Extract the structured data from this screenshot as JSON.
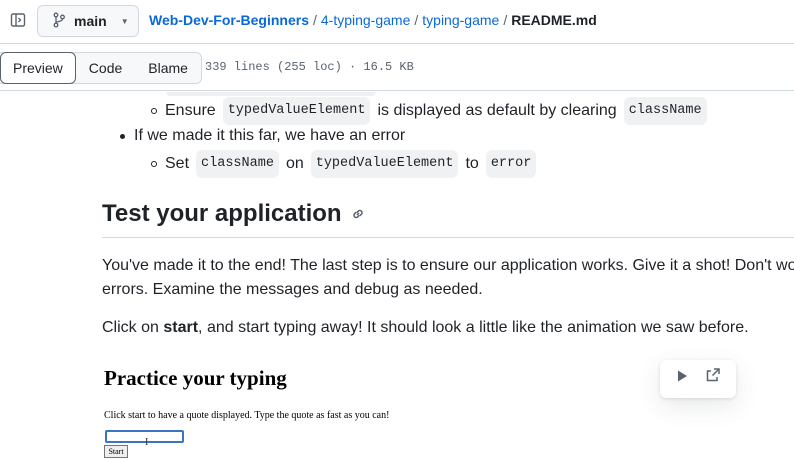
{
  "header": {
    "branch": "main",
    "breadcrumb": {
      "repo": "Web-Dev-For-Beginners",
      "folder1": "4-typing-game",
      "folder2": "typing-game",
      "file": "README.md",
      "separator": "/"
    }
  },
  "toolbar": {
    "tabs": [
      "Preview",
      "Code",
      "Blame"
    ],
    "active_tab": "Preview",
    "file_meta": "339 lines (255 loc) · 16.5 KB"
  },
  "content": {
    "list": {
      "item1": {
        "word1": "Ensure",
        "code1": "typedValueElement",
        "text": "is displayed as default by clearing",
        "code2": "className"
      },
      "bullet": "If we made it this far, we have an error",
      "item2": {
        "word": "Set",
        "code1": "className",
        "on": "on",
        "code2": "typedValueElement",
        "to": "to",
        "code3": "error"
      }
    },
    "heading": "Test your application",
    "para1_line1": "You've made it to the end! The last step is to ensure our application works. Give it a shot! Don't wo",
    "para1_line2": "errors. Examine the messages and debug as needed.",
    "para2_pre": "Click on ",
    "para2_bold": "start",
    "para2_post": ", and start typing away! It should look a little like the animation we saw before.",
    "demo": {
      "title": "Practice your typing",
      "subtitle": "Click start to have a quote displayed. Type the quote as fast as you can!",
      "cursor": "I",
      "start_button": "Start"
    }
  },
  "icons": {
    "panel": "sidebar-expand-icon",
    "branch": "git-branch-icon",
    "caret": "triangle-down-icon",
    "anchor": "link-icon",
    "play": "play-icon",
    "expand": "link-external-icon"
  },
  "colors": {
    "link": "#0969da",
    "text": "#1f2328",
    "muted": "#59636e",
    "border": "#d1d9e0",
    "code_bg": "#eff1f3"
  }
}
